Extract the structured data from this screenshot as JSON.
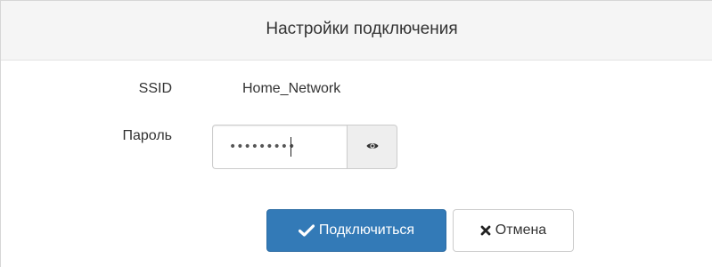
{
  "dialog": {
    "title": "Настройки подключения"
  },
  "form": {
    "ssid_label": "SSID",
    "ssid_value": "Home_Network",
    "password_label": "Пароль",
    "password_value": "•••••••••"
  },
  "buttons": {
    "connect_label": "Подключиться",
    "connect_icon": "check-icon",
    "cancel_label": "Отмена",
    "cancel_icon": "close-icon",
    "toggle_visibility_icon": "eye-icon"
  },
  "colors": {
    "primary": "#337ab7",
    "header_bg": "#f5f5f5"
  }
}
